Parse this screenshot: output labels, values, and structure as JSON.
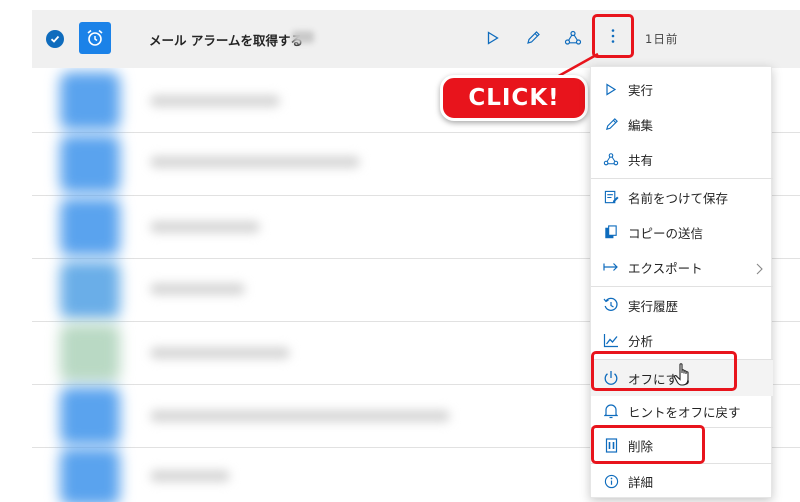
{
  "selected_flow": {
    "title": "メール アラームを取得する",
    "time": "1日前",
    "actions": [
      "play-icon",
      "edit-icon",
      "share-icon",
      "more-icon"
    ]
  },
  "annotation": {
    "badge_text": "CLICK!",
    "badge_color": "#e8141c"
  },
  "context_menu": {
    "items": [
      {
        "label": "実行",
        "icon": "play-icon"
      },
      {
        "label": "編集",
        "icon": "edit-icon"
      },
      {
        "label": "共有",
        "icon": "share-icon"
      },
      {
        "label": "名前をつけて保存",
        "icon": "save-as-icon"
      },
      {
        "label": "コピーの送信",
        "icon": "copy-icon"
      },
      {
        "label": "エクスポート",
        "icon": "export-icon",
        "submenu": true
      },
      {
        "label": "実行履歴",
        "icon": "history-icon"
      },
      {
        "label": "分析",
        "icon": "analytics-icon"
      },
      {
        "label": "オフにする",
        "icon": "power-icon"
      },
      {
        "label": "ヒントをオフに戻す",
        "icon": "bell-icon"
      },
      {
        "label": "削除",
        "icon": "trash-icon"
      },
      {
        "label": "詳細",
        "icon": "info-icon"
      }
    ]
  },
  "colors": {
    "accent": "#0f6cbd",
    "flow_icon": "#1b82e8",
    "highlight": "#e8141c"
  }
}
